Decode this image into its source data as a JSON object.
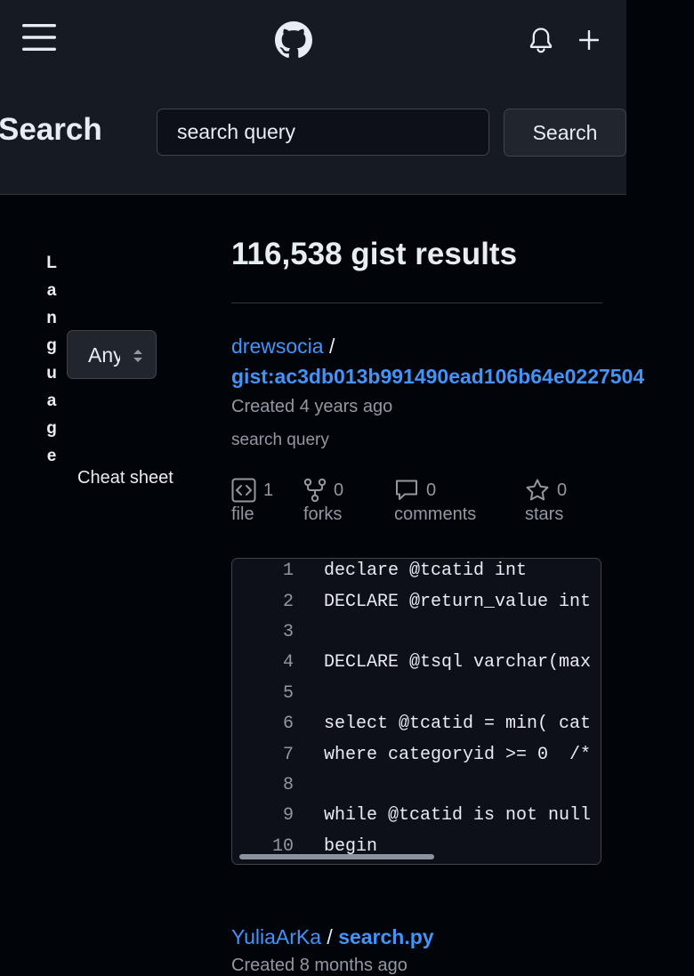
{
  "header": {
    "menu_icon": "hamburger-menu-icon",
    "logo_icon": "github-octocat-icon",
    "bell_icon": "bell-icon",
    "plus_icon": "plus-icon",
    "title": "Search",
    "search_value": "search query",
    "search_button": "Search"
  },
  "sidebar": {
    "language_label": "Language",
    "language_value": "Any",
    "cheat_sheet": "Cheat sheet"
  },
  "results": {
    "heading": "116,538 gist results",
    "items": [
      {
        "owner": "drewsocia",
        "separator": "/",
        "gist": "gist:ac3db013b991490ead106b64e0227504",
        "created": "Created 4 years ago",
        "description": "search query",
        "stats": {
          "files": {
            "count": "1",
            "label": "file",
            "icon": "code-square-icon"
          },
          "forks": {
            "count": "0",
            "label": "forks",
            "icon": "fork-icon"
          },
          "comments": {
            "count": "0",
            "label": "comments",
            "icon": "comment-icon"
          },
          "stars": {
            "count": "0",
            "label": "stars",
            "icon": "star-icon"
          }
        },
        "code": [
          {
            "n": "1",
            "t": "declare @tcatid int"
          },
          {
            "n": "2",
            "t": "DECLARE @return_value int"
          },
          {
            "n": "3",
            "t": ""
          },
          {
            "n": "4",
            "t": "DECLARE @tsql varchar(max"
          },
          {
            "n": "5",
            "t": ""
          },
          {
            "n": "6",
            "t": "select @tcatid = min( cat"
          },
          {
            "n": "7",
            "t": "where categoryid >= 0  /*"
          },
          {
            "n": "8",
            "t": ""
          },
          {
            "n": "9",
            "t": "while @tcatid is not null"
          },
          {
            "n": "10",
            "t": "begin"
          }
        ]
      },
      {
        "owner": "YuliaArKa",
        "separator": "/",
        "gist": "search.py",
        "created": "Created 8 months ago"
      }
    ]
  },
  "colors": {
    "background": "#010409",
    "header_bg": "#161b22",
    "link": "#4493f8",
    "muted": "#9198a1",
    "text": "#e6edf3"
  }
}
